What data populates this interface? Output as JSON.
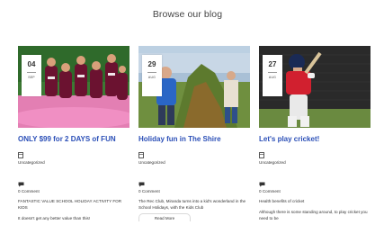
{
  "section": {
    "title": "Browse our blog"
  },
  "posts": [
    {
      "day": "04",
      "month": "SEP",
      "title": "ONLY $99 for 2 DAYS of FUN",
      "category": "Uncategorized",
      "comments": "0 Comment",
      "excerpt": "FANTASTIC VALUE SCHOOL HOLIDAY ACTIVITY FOR KIDS",
      "excerpt2": "It doesn't get any better value than this!"
    },
    {
      "day": "29",
      "month": "AUG",
      "title": "Holiday fun in The Shire",
      "category": "Uncategorized",
      "comments": "0 Comment",
      "excerpt": "The Rec Club, Miranda turns into a kid's wonderland in the School Holidays, with the Kids Club",
      "read_more": "Read More"
    },
    {
      "day": "27",
      "month": "AUG",
      "title": "Let's play cricket!",
      "category": "Uncategorized",
      "comments": "0 Comment",
      "excerpt": "Health benefits of cricket",
      "excerpt2": "Although there is some standing around, to play cricket you need to be"
    }
  ],
  "icons": {
    "category": "folder-icon",
    "comments": "comment-icon"
  },
  "colors": {
    "title": "#2b4fb7",
    "background": "#ffffff"
  }
}
